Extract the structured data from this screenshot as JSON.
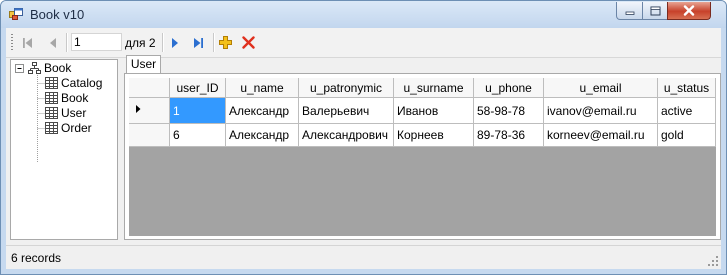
{
  "window": {
    "title": "Book v10"
  },
  "navigator": {
    "position_value": "1",
    "count_label": "для 2",
    "icons": [
      "move-first-icon",
      "move-previous-icon",
      "move-next-icon",
      "move-last-icon",
      "add-new-icon",
      "delete-icon"
    ]
  },
  "tree": {
    "root": "Book",
    "children": [
      "Catalog",
      "Book",
      "User",
      "Order"
    ]
  },
  "tab": {
    "label": "User"
  },
  "grid": {
    "columns": [
      "user_ID",
      "u_name",
      "u_patronymic",
      "u_surname",
      "u_phone",
      "u_email",
      "u_status"
    ],
    "rows": [
      [
        "1",
        "Александр",
        "Валерьевич",
        "Иванов",
        "58-98-78",
        "ivanov@email.ru",
        "active"
      ],
      [
        "6",
        "Александр",
        "Александрович",
        "Корнеев",
        "89-78-36",
        "korneev@email.ru",
        "gold"
      ]
    ]
  },
  "status": {
    "text": "6 records"
  },
  "colors": {
    "selection": "#3399ff",
    "grid_background": "#a3a3a3",
    "titlebar": "#c6d9ef",
    "close_button": "#c7412a"
  }
}
